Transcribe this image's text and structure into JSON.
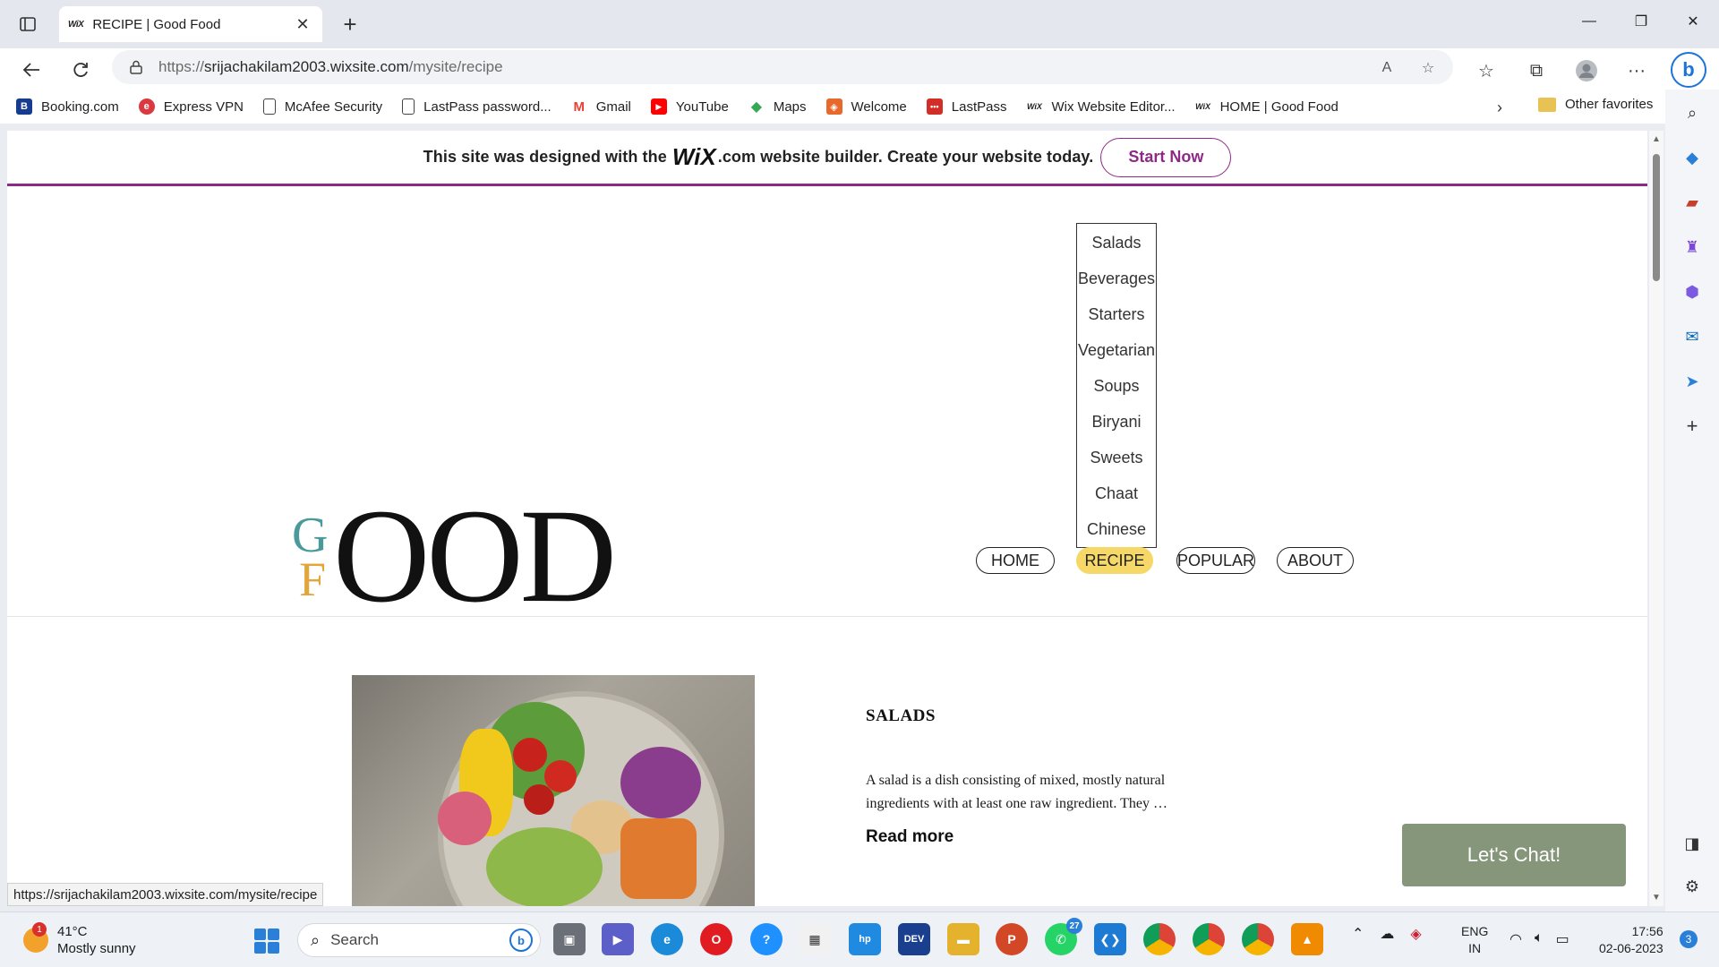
{
  "browser": {
    "tab": {
      "favicon_text": "WiX",
      "title": "RECIPE | Good Food"
    },
    "new_tab_symbol": "+",
    "url_prefix": "https://",
    "url_host": "srijachakilam2003.wixsite.com",
    "url_path": "/mysite/recipe",
    "read_aloud_label": "A",
    "bing_label": "b",
    "favorites": [
      {
        "label": "Booking.com",
        "icon": "B",
        "color": "#163b8f"
      },
      {
        "label": "Express VPN",
        "icon": "e",
        "color": "#da3940"
      },
      {
        "label": "McAfee Security",
        "icon": "",
        "color": "#ffffff"
      },
      {
        "label": "LastPass password...",
        "icon": "",
        "color": "#ffffff"
      },
      {
        "label": "Gmail",
        "icon": "M",
        "color": "#ea4335"
      },
      {
        "label": "YouTube",
        "icon": "▶",
        "color": "#ff0000"
      },
      {
        "label": "Maps",
        "icon": "◆",
        "color": "#34a853"
      },
      {
        "label": "Welcome",
        "icon": "◈",
        "color": "#e8692c"
      },
      {
        "label": "LastPass",
        "icon": "•••",
        "color": "#d32d27"
      },
      {
        "label": "Wix Website Editor...",
        "icon": "WiX",
        "color": "#ffffff"
      },
      {
        "label": "HOME | Good Food",
        "icon": "WiX",
        "color": "#ffffff"
      }
    ],
    "other_favorites": "Other favorites",
    "status_url": "https://srijachakilam2003.wixsite.com/mysite/recipe"
  },
  "site": {
    "banner_before": "This site was designed with the",
    "banner_logo": "WiX",
    "banner_after": ".com website builder. Create your website today.",
    "start_now": "Start Now",
    "dropdown_items": [
      "Salads",
      "Beverages",
      "Starters",
      "Vegetarian",
      "Soups",
      "Biryani",
      "Sweets",
      "Chaat",
      "Chinese"
    ],
    "logo": {
      "g": "G",
      "f": "F",
      "ood": "OOD"
    },
    "nav": [
      "HOME",
      "RECIPE",
      "POPULAR",
      "ABOUT"
    ],
    "active_nav": "RECIPE",
    "post": {
      "title": "SALADS",
      "excerpt": "A salad is a dish consisting of mixed, mostly natural ingredients with at least one raw ingredient. They …",
      "read_more": "Read more"
    },
    "chat_label": "Let's Chat!"
  },
  "taskbar": {
    "temperature": "41°C",
    "weather": "Mostly sunny",
    "weather_badge": "1",
    "search_placeholder": "Search",
    "whatsapp_badge": "27",
    "lang_top": "ENG",
    "lang_bottom": "IN",
    "time": "17:56",
    "date": "02-06-2023",
    "notifications": "3"
  },
  "colors": {
    "wix_purple": "#8d2a88",
    "active_pill": "#f5d867",
    "chat_green": "#86967a",
    "logo_g": "#4a9a9c",
    "logo_f": "#e2a63a"
  }
}
